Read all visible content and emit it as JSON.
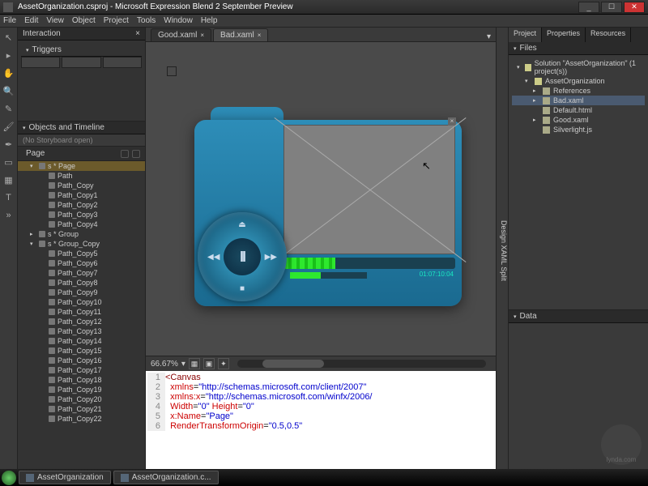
{
  "titlebar": {
    "title": "AssetOrganization.csproj - Microsoft Expression Blend 2 September Preview"
  },
  "menu": [
    "File",
    "Edit",
    "View",
    "Object",
    "Project",
    "Tools",
    "Window",
    "Help"
  ],
  "leftpanel": {
    "interaction": "Interaction",
    "triggers": "Triggers",
    "objects": "Objects and Timeline",
    "storyboard": "(No Storyboard open)",
    "page": "Page"
  },
  "tree": [
    {
      "ind": 0,
      "exp": "▾",
      "label": "s * Page",
      "sel": true
    },
    {
      "ind": 1,
      "exp": "",
      "label": "Path"
    },
    {
      "ind": 1,
      "exp": "",
      "label": "Path_Copy"
    },
    {
      "ind": 1,
      "exp": "",
      "label": "Path_Copy1"
    },
    {
      "ind": 1,
      "exp": "",
      "label": "Path_Copy2"
    },
    {
      "ind": 1,
      "exp": "",
      "label": "Path_Copy3"
    },
    {
      "ind": 1,
      "exp": "",
      "label": "Path_Copy4"
    },
    {
      "ind": 0,
      "exp": "▸",
      "label": "s * Group"
    },
    {
      "ind": 0,
      "exp": "▾",
      "label": "s * Group_Copy"
    },
    {
      "ind": 1,
      "exp": "",
      "label": "Path_Copy5"
    },
    {
      "ind": 1,
      "exp": "",
      "label": "Path_Copy6"
    },
    {
      "ind": 1,
      "exp": "",
      "label": "Path_Copy7"
    },
    {
      "ind": 1,
      "exp": "",
      "label": "Path_Copy8"
    },
    {
      "ind": 1,
      "exp": "",
      "label": "Path_Copy9"
    },
    {
      "ind": 1,
      "exp": "",
      "label": "Path_Copy10"
    },
    {
      "ind": 1,
      "exp": "",
      "label": "Path_Copy11"
    },
    {
      "ind": 1,
      "exp": "",
      "label": "Path_Copy12"
    },
    {
      "ind": 1,
      "exp": "",
      "label": "Path_Copy13"
    },
    {
      "ind": 1,
      "exp": "",
      "label": "Path_Copy14"
    },
    {
      "ind": 1,
      "exp": "",
      "label": "Path_Copy15"
    },
    {
      "ind": 1,
      "exp": "",
      "label": "Path_Copy16"
    },
    {
      "ind": 1,
      "exp": "",
      "label": "Path_Copy17"
    },
    {
      "ind": 1,
      "exp": "",
      "label": "Path_Copy18"
    },
    {
      "ind": 1,
      "exp": "",
      "label": "Path_Copy19"
    },
    {
      "ind": 1,
      "exp": "",
      "label": "Path_Copy20"
    },
    {
      "ind": 1,
      "exp": "",
      "label": "Path_Copy21"
    },
    {
      "ind": 1,
      "exp": "",
      "label": "Path_Copy22"
    }
  ],
  "tabs": {
    "t1": "Good.xaml",
    "t2": "Bad.xaml"
  },
  "player": {
    "timecode": "01:07:10:04",
    "pause": "II"
  },
  "zoom": "66.67%",
  "code": {
    "l1": "<Canvas",
    "l2_a": "  xmlns",
    "l2_v": "\"http://schemas.microsoft.com/client/2007\"",
    "l3_a": "  xmlns:x",
    "l3_v": "\"http://schemas.microsoft.com/winfx/2006/",
    "l4_a": "  Width",
    "l4_v": "\"0\"",
    "l4_a2": " Height",
    "l4_v2": "\"0\"",
    "l5_a": "  x:Name",
    "l5_v": "\"Page\"",
    "l6_a": "  RenderTransformOrigin",
    "l6_v": "\"0.5,0.5\""
  },
  "rightstrip": {
    "label": "Design   XAML   Split"
  },
  "rtabs": [
    "Project",
    "Properties",
    "Resources"
  ],
  "files_header": "Files",
  "files": [
    {
      "ind": 0,
      "exp": "▾",
      "label": "Solution \"AssetOrganization\" (1 project(s))"
    },
    {
      "ind": 1,
      "exp": "▾",
      "label": "AssetOrganization"
    },
    {
      "ind": 2,
      "exp": "▸",
      "label": "References"
    },
    {
      "ind": 2,
      "exp": "▸",
      "label": "Bad.xaml",
      "sel": true
    },
    {
      "ind": 2,
      "exp": "",
      "label": "Default.html"
    },
    {
      "ind": 2,
      "exp": "▸",
      "label": "Good.xaml"
    },
    {
      "ind": 2,
      "exp": "",
      "label": "Silverlight.js"
    }
  ],
  "data_header": "Data",
  "taskbar": {
    "t1": "AssetOrganization",
    "t2": "AssetOrganization.c..."
  },
  "watermark": "lynda.com"
}
